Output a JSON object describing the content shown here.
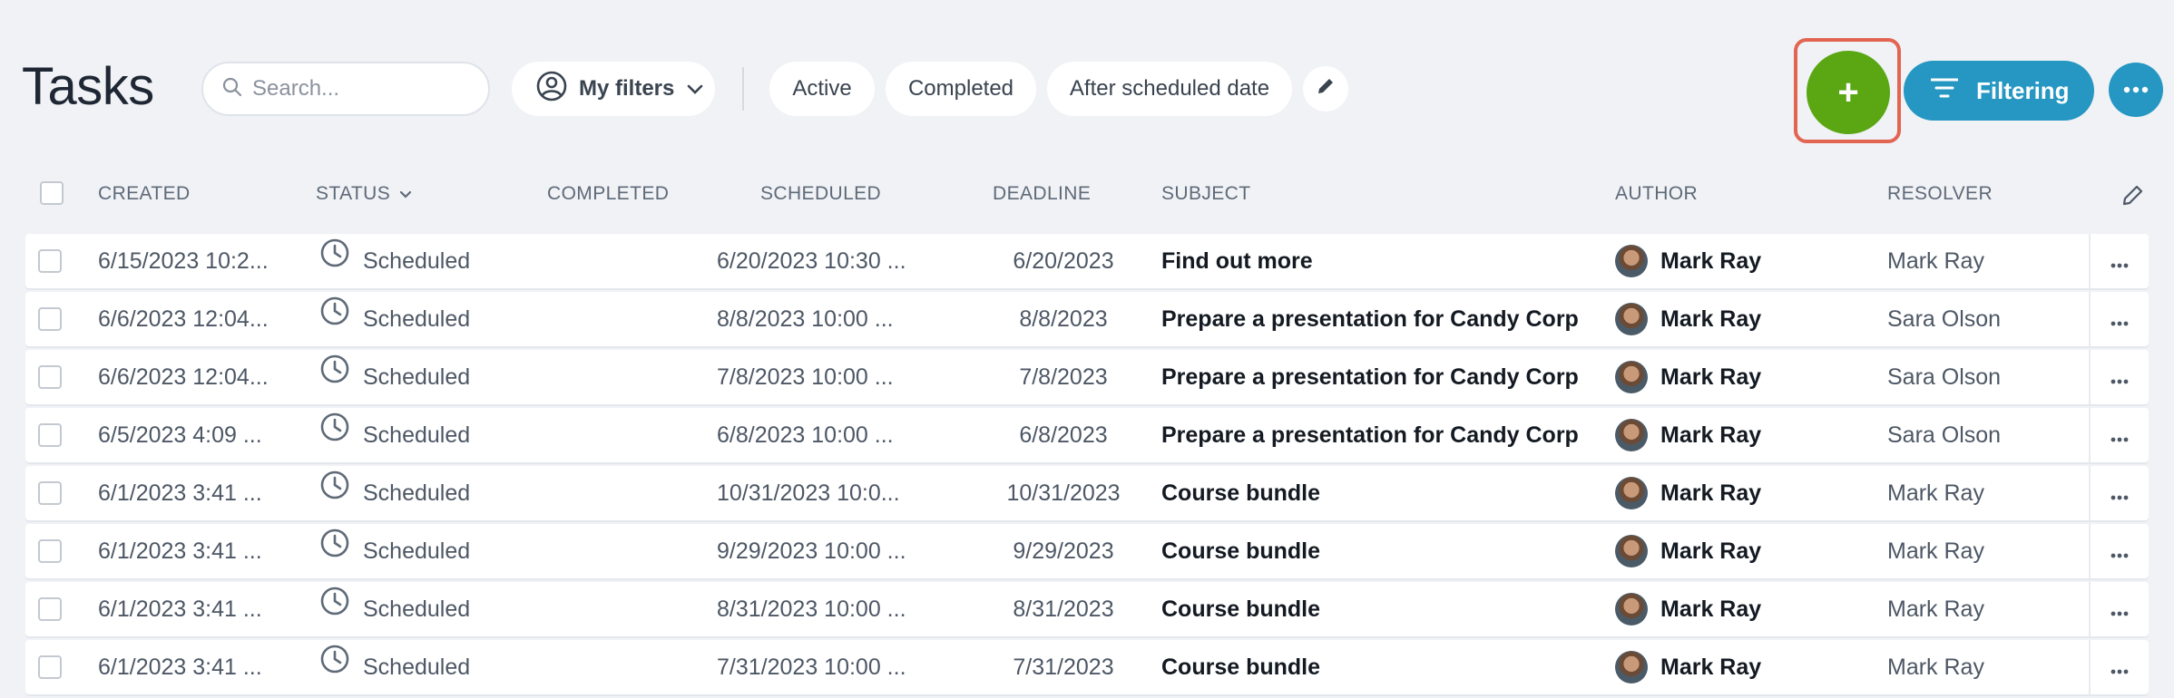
{
  "header": {
    "title": "Tasks",
    "search_placeholder": "Search...",
    "my_filters_label": "My filters",
    "filter_pills": [
      "Active",
      "Completed",
      "After scheduled date"
    ],
    "add_label": "+",
    "filtering_label": "Filtering"
  },
  "colors": {
    "add_button": "#5aa713",
    "add_highlight": "#e26552",
    "primary": "#2597c2"
  },
  "table": {
    "columns": [
      "CREATED",
      "STATUS",
      "COMPLETED",
      "SCHEDULED",
      "DEADLINE",
      "SUBJECT",
      "AUTHOR",
      "RESOLVER"
    ],
    "rows": [
      {
        "created": "6/15/2023 10:2...",
        "status": "Scheduled",
        "completed": "",
        "scheduled": "6/20/2023 10:30 ...",
        "deadline": "6/20/2023",
        "subject": "Find out more",
        "author": "Mark Ray",
        "resolver": "Mark Ray"
      },
      {
        "created": "6/6/2023 12:04...",
        "status": "Scheduled",
        "completed": "",
        "scheduled": "8/8/2023 10:00 ...",
        "deadline": "8/8/2023",
        "subject": "Prepare a presentation for Candy Corp",
        "author": "Mark Ray",
        "resolver": "Sara Olson"
      },
      {
        "created": "6/6/2023 12:04...",
        "status": "Scheduled",
        "completed": "",
        "scheduled": "7/8/2023 10:00 ...",
        "deadline": "7/8/2023",
        "subject": "Prepare a presentation for Candy Corp",
        "author": "Mark Ray",
        "resolver": "Sara Olson"
      },
      {
        "created": "6/5/2023 4:09 ...",
        "status": "Scheduled",
        "completed": "",
        "scheduled": "6/8/2023 10:00 ...",
        "deadline": "6/8/2023",
        "subject": "Prepare a presentation for Candy Corp",
        "author": "Mark Ray",
        "resolver": "Sara Olson"
      },
      {
        "created": "6/1/2023 3:41 ...",
        "status": "Scheduled",
        "completed": "",
        "scheduled": "10/31/2023 10:0...",
        "deadline": "10/31/2023",
        "subject": "Course bundle",
        "author": "Mark Ray",
        "resolver": "Mark Ray"
      },
      {
        "created": "6/1/2023 3:41 ...",
        "status": "Scheduled",
        "completed": "",
        "scheduled": "9/29/2023 10:00 ...",
        "deadline": "9/29/2023",
        "subject": "Course bundle",
        "author": "Mark Ray",
        "resolver": "Mark Ray"
      },
      {
        "created": "6/1/2023 3:41 ...",
        "status": "Scheduled",
        "completed": "",
        "scheduled": "8/31/2023 10:00 ...",
        "deadline": "8/31/2023",
        "subject": "Course bundle",
        "author": "Mark Ray",
        "resolver": "Mark Ray"
      },
      {
        "created": "6/1/2023 3:41 ...",
        "status": "Scheduled",
        "completed": "",
        "scheduled": "7/31/2023 10:00 ...",
        "deadline": "7/31/2023",
        "subject": "Course bundle",
        "author": "Mark Ray",
        "resolver": "Mark Ray"
      }
    ]
  }
}
